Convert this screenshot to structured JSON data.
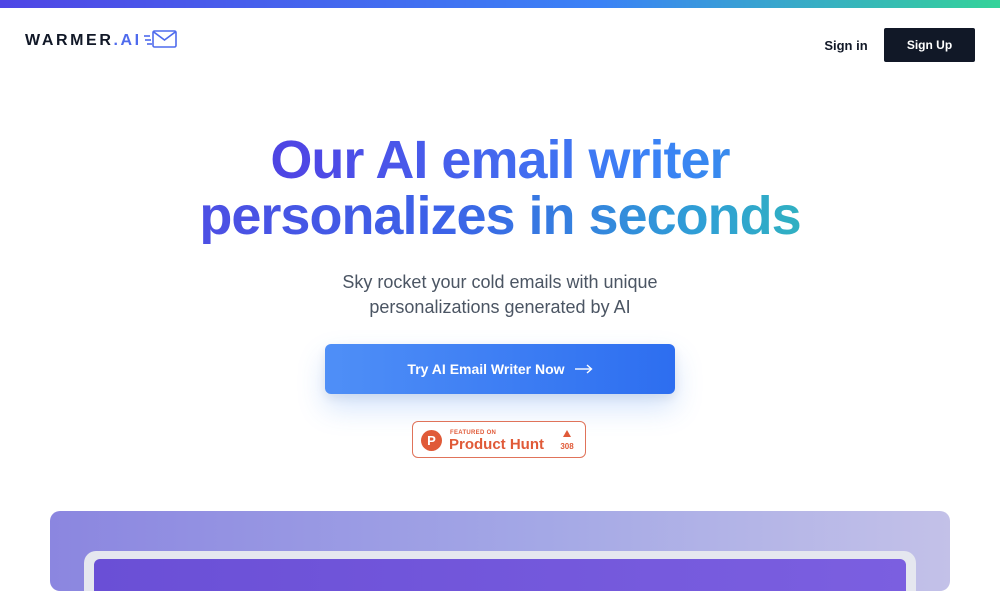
{
  "header": {
    "logo": {
      "text_main": "WARMER",
      "text_suffix": ".AI",
      "icon": "envelope-speed-icon"
    },
    "nav": {
      "sign_in": "Sign in",
      "sign_up": "Sign Up"
    }
  },
  "hero": {
    "title_line_1": "Our AI email writer",
    "title_line_2": "personalizes in seconds",
    "subtitle_line_1": "Sky rocket your cold emails with unique",
    "subtitle_line_2": "personalizations generated by AI",
    "cta_label": "Try AI Email Writer Now",
    "cta_icon": "arrow-right-icon"
  },
  "product_hunt": {
    "logo_letter": "P",
    "featured_label": "FEATURED ON",
    "name": "Product Hunt",
    "upvote_icon": "triangle-up-icon",
    "upvotes": "308"
  },
  "colors": {
    "accent_blue": "#3b82f6",
    "dark": "#111827",
    "product_hunt": "#e05a38"
  }
}
